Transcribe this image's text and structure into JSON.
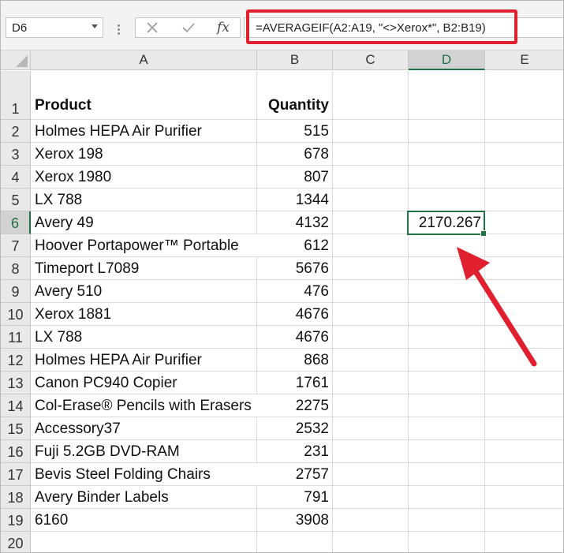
{
  "name_box": {
    "value": "D6"
  },
  "formula_bar": {
    "formula": "=AVERAGEIF(A2:A19, \"<>Xerox*\", B2:B19)",
    "fx_label": "fx"
  },
  "columns": [
    "A",
    "B",
    "C",
    "D",
    "E"
  ],
  "rows": [
    {
      "num": "1",
      "a": "Product",
      "b": "Quantity",
      "header": true
    },
    {
      "num": "2",
      "a": "Holmes HEPA Air Purifier",
      "b": "515"
    },
    {
      "num": "3",
      "a": "Xerox 198",
      "b": "678"
    },
    {
      "num": "4",
      "a": "Xerox 1980",
      "b": "807"
    },
    {
      "num": "5",
      "a": "LX 788",
      "b": "1344"
    },
    {
      "num": "6",
      "a": "Avery 49",
      "b": "4132"
    },
    {
      "num": "7",
      "a": "Hoover Portapower™ Portable",
      "b": "612"
    },
    {
      "num": "8",
      "a": "Timeport L7089",
      "b": "5676"
    },
    {
      "num": "9",
      "a": "Avery 510",
      "b": "476"
    },
    {
      "num": "10",
      "a": "Xerox 1881",
      "b": "4676"
    },
    {
      "num": "11",
      "a": "LX 788",
      "b": "4676"
    },
    {
      "num": "12",
      "a": "Holmes HEPA Air Purifier",
      "b": "868"
    },
    {
      "num": "13",
      "a": "Canon PC940 Copier",
      "b": "1761"
    },
    {
      "num": "14",
      "a": "Col-Erase® Pencils with Erasers",
      "b": "2275"
    },
    {
      "num": "15",
      "a": "Accessory37",
      "b": "2532"
    },
    {
      "num": "16",
      "a": "Fuji 5.2GB DVD-RAM",
      "b": "231"
    },
    {
      "num": "17",
      "a": "Bevis Steel Folding Chairs",
      "b": "2757"
    },
    {
      "num": "18",
      "a": "Avery Binder Labels",
      "b": "791"
    },
    {
      "num": "19",
      "a": "6160",
      "b": "3908"
    },
    {
      "num": "20",
      "a": "",
      "b": ""
    }
  ],
  "active_cell": {
    "ref": "D6",
    "value": "2170.267"
  },
  "colors": {
    "annotation_red": "#e0202f",
    "excel_green": "#217346"
  }
}
